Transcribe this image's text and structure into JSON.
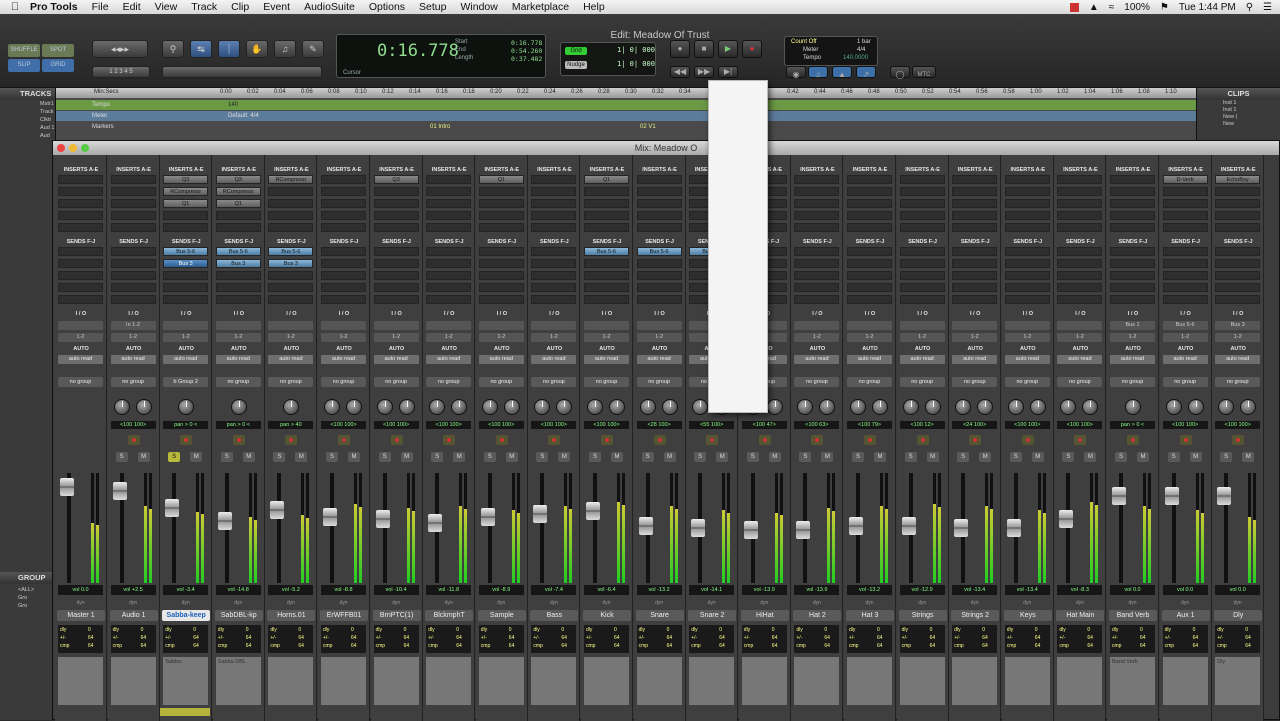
{
  "menubar": {
    "app": "Pro Tools",
    "items": [
      "File",
      "Edit",
      "View",
      "Track",
      "Clip",
      "Event",
      "AudioSuite",
      "Options",
      "Setup",
      "Window",
      "Marketplace",
      "Help"
    ],
    "battery": "100%",
    "clock": "Tue 1:44 PM"
  },
  "edit_window": {
    "title": "Edit: Meadow Of Trust",
    "modes": [
      "SHUFFLE",
      "SPOT",
      "SLIP",
      "GRID"
    ],
    "zoom_presets": [
      "1",
      "2",
      "3",
      "4",
      "5"
    ],
    "counter": "0:16.778",
    "counter_labels": [
      "Start",
      "End",
      "Length"
    ],
    "counter_values": [
      "0:16.778",
      "0:54.260",
      "0:37.482"
    ],
    "cursor_label": "Cursor",
    "grid_label": "Grid",
    "grid_value": "1| 0| 000",
    "nudge_label": "Nudge",
    "nudge_value": "1| 0| 000",
    "countoff_label": "Count Off",
    "countoff_value": "1 bar",
    "meter_label": "Meter",
    "meter_value": "4/4",
    "tempo_label": "Tempo",
    "tempo_value": "140.0000",
    "mtc": "MTC"
  },
  "tracks_panel": {
    "header": "TRACKS",
    "rows": [
      "Mstr1",
      "Track",
      "Clktr",
      "Aud 1",
      "Aud"
    ],
    "group_header": "GROUP",
    "groups": [
      "<ALL>",
      "Gro",
      "Gro"
    ]
  },
  "timeline": {
    "ruler_main": "Min:Secs",
    "ticks": [
      "0:00",
      "0:02",
      "0:04",
      "0:06",
      "0:08",
      "0:10",
      "0:12",
      "0:14",
      "0:16",
      "0:18",
      "0:20",
      "0:22",
      "0:24",
      "0:26",
      "0:28",
      "0:30",
      "0:32",
      "0:34",
      "0:42",
      "0:44",
      "0:46",
      "0:48",
      "0:50",
      "0:52",
      "0:54",
      "0:56",
      "0:58",
      "1:00",
      "1:02",
      "1:04",
      "1:06",
      "1:08",
      "1:10"
    ],
    "rows": [
      {
        "name": "Tempo",
        "value": "140"
      },
      {
        "name": "Meter",
        "value": "Default: 4/4"
      },
      {
        "name": "Markers",
        "value": ""
      }
    ],
    "markers": [
      "01 Intro",
      "02 V1"
    ]
  },
  "clips_panel": {
    "header": "CLIPS",
    "rows": [
      "Inst 1",
      "Inst 1",
      "New (",
      "New"
    ]
  },
  "mix_window": {
    "title": "Mix: Meadow O",
    "strips": [
      {
        "name": "Master 1",
        "inserts": [],
        "sends": [],
        "io_in": "",
        "io_out": "1-2",
        "group": "no group",
        "pan": "",
        "vol": "0.0",
        "sel": false,
        "comment": ""
      },
      {
        "name": "Audio 1",
        "inserts": [],
        "sends": [],
        "io_in": "In 1-2",
        "io_out": "1-2",
        "group": "no group",
        "pan": "<100 100>",
        "vol": "+2.5",
        "sel": false,
        "comment": ""
      },
      {
        "name": "Sabba-keep",
        "inserts": [
          "Q3",
          "RCompressr",
          "Q1"
        ],
        "sends": [
          "Bus 5-6",
          "Bus 3"
        ],
        "io_in": "",
        "io_out": "1-2",
        "group": "b Group 2",
        "pan": "pan > 0 <",
        "vol": "-3.4",
        "sel": true,
        "comment": "Sabba"
      },
      {
        "name": "SabDBL-kp",
        "inserts": [
          "Q3",
          "RCompressr",
          "Q1"
        ],
        "sends": [
          "Bus 5-6",
          "Bus 3"
        ],
        "io_in": "",
        "io_out": "1-2",
        "group": "no group",
        "pan": "pan > 0 <",
        "vol": "-14.8",
        "sel": false,
        "comment": "Sabba DBL"
      },
      {
        "name": "Horns.01",
        "inserts": [
          "RCompressr"
        ],
        "sends": [
          "Bus 5-6",
          "Bus 3"
        ],
        "io_in": "",
        "io_out": "1-2",
        "group": "no group",
        "pan": "pan > 40",
        "vol": "-5.2",
        "sel": false,
        "comment": ""
      },
      {
        "name": "ErWFFB01",
        "inserts": [],
        "sends": [],
        "io_in": "",
        "io_out": "1-2",
        "group": "no group",
        "pan": "<100 100>",
        "vol": "-8.8",
        "sel": false,
        "comment": ""
      },
      {
        "name": "BrnPTC(1)",
        "inserts": [
          "Q3"
        ],
        "sends": [],
        "io_in": "",
        "io_out": "1-2",
        "group": "no group",
        "pan": "<100 100>",
        "vol": "-10.4",
        "sel": false,
        "comment": ""
      },
      {
        "name": "BlckmphT",
        "inserts": [],
        "sends": [],
        "io_in": "",
        "io_out": "1-2",
        "group": "no group",
        "pan": "<100 100>",
        "vol": "-11.8",
        "sel": false,
        "comment": ""
      },
      {
        "name": "Sample",
        "inserts": [
          "Q1"
        ],
        "sends": [],
        "io_in": "",
        "io_out": "1-2",
        "group": "no group",
        "pan": "<100 100>",
        "vol": "-8.9",
        "sel": false,
        "comment": ""
      },
      {
        "name": "Bass",
        "inserts": [],
        "sends": [],
        "io_in": "",
        "io_out": "1-2",
        "group": "no group",
        "pan": "<100 100>",
        "vol": "-7.4",
        "sel": false,
        "comment": ""
      },
      {
        "name": "Kick",
        "inserts": [
          "Q1"
        ],
        "sends": [
          "Bus 5-6"
        ],
        "io_in": "",
        "io_out": "1-2",
        "group": "no group",
        "pan": "<100 100>",
        "vol": "-6.4",
        "sel": false,
        "comment": ""
      },
      {
        "name": "Snare",
        "inserts": [],
        "sends": [
          "Bus 5-6"
        ],
        "io_in": "",
        "io_out": "1-2",
        "group": "no group",
        "pan": "<28 100>",
        "vol": "-13.2",
        "sel": false,
        "comment": ""
      },
      {
        "name": "Snare 2",
        "inserts": [],
        "sends": [
          "Bus 5-6"
        ],
        "io_in": "",
        "io_out": "1-2",
        "group": "no group",
        "pan": "<55 100>",
        "vol": "-14.1",
        "sel": false,
        "comment": ""
      },
      {
        "name": "HiHat",
        "inserts": [],
        "sends": [],
        "io_in": "",
        "io_out": "1-2",
        "group": "no group",
        "pan": "<100 47>",
        "vol": "-13.9",
        "sel": false,
        "comment": ""
      },
      {
        "name": "Hat 2",
        "inserts": [],
        "sends": [],
        "io_in": "",
        "io_out": "1-2",
        "group": "no group",
        "pan": "<100 63>",
        "vol": "-13.9",
        "sel": false,
        "comment": ""
      },
      {
        "name": "Hat 3",
        "inserts": [],
        "sends": [],
        "io_in": "",
        "io_out": "1-2",
        "group": "no group",
        "pan": "<100 79>",
        "vol": "-13.2",
        "sel": false,
        "comment": ""
      },
      {
        "name": "Strings",
        "inserts": [],
        "sends": [],
        "io_in": "",
        "io_out": "1-2",
        "group": "no group",
        "pan": "<100 12>",
        "vol": "-12.9",
        "sel": false,
        "comment": ""
      },
      {
        "name": "Strings 2",
        "inserts": [],
        "sends": [],
        "io_in": "",
        "io_out": "1-2",
        "group": "no group",
        "pan": "<24 100>",
        "vol": "-13.4",
        "sel": false,
        "comment": ""
      },
      {
        "name": "Keys",
        "inserts": [],
        "sends": [],
        "io_in": "",
        "io_out": "1-2",
        "group": "no group",
        "pan": "<100 100>",
        "vol": "-13.4",
        "sel": false,
        "comment": ""
      },
      {
        "name": "Hat Main",
        "inserts": [],
        "sends": [],
        "io_in": "",
        "io_out": "1-2",
        "group": "no group",
        "pan": "<100 100>",
        "vol": "-8.3",
        "sel": false,
        "comment": ""
      },
      {
        "name": "Band Verb",
        "inserts": [],
        "sends": [],
        "io_in": "Bus 1",
        "io_out": "1-2",
        "group": "no group",
        "pan": "pan > 0 <",
        "vol": "0.0",
        "sel": false,
        "comment": "Band Verb"
      },
      {
        "name": "Aux 1",
        "inserts": [
          "D-Verb"
        ],
        "sends": [],
        "io_in": "Bus 5-6",
        "io_out": "1-2",
        "group": "no group",
        "pan": "<100 100>",
        "vol": "0.0",
        "sel": false,
        "comment": ""
      },
      {
        "name": "Dly",
        "inserts": [
          "EchoBoy"
        ],
        "sends": [],
        "io_in": "Bus 3",
        "io_out": "1-2",
        "group": "no group",
        "pan": "<100 100>",
        "vol": "0.0",
        "sel": false,
        "comment": "Dly"
      }
    ],
    "labels": {
      "inserts": "INSERTS A-E",
      "sends": "SENDS F-J",
      "io": "I / O",
      "auto": "AUTO",
      "auto_mode": "auto read",
      "solo": "S",
      "mute": "M",
      "vol": "vol",
      "dyn": "dyn",
      "comp": [
        "dly",
        "0",
        "+/-",
        "64",
        "cmp",
        "64"
      ]
    }
  }
}
